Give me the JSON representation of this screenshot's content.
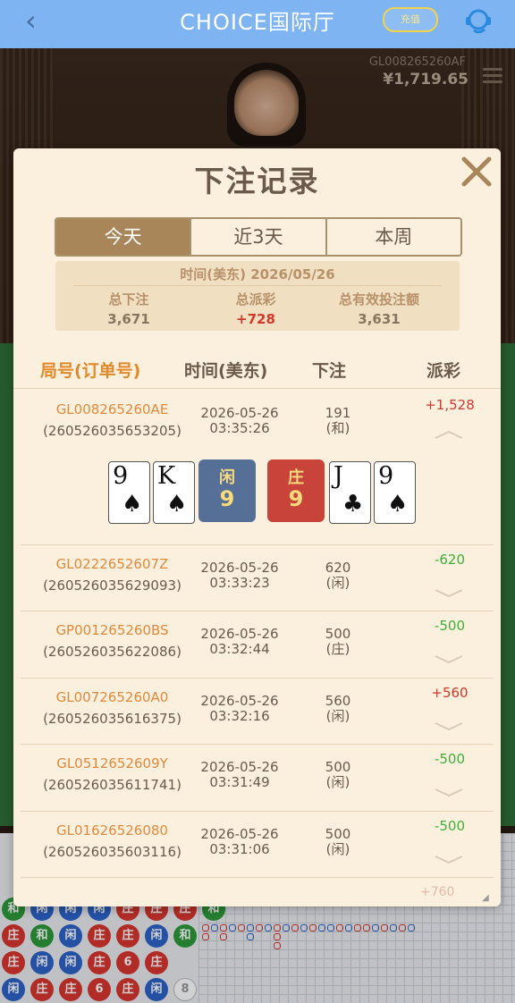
{
  "header": {
    "title": "CHOICE国际厅",
    "pill_label": "充值"
  },
  "video": {
    "game_id": "GL008265260AF",
    "balance": "¥1,719.65"
  },
  "modal": {
    "title": "下注记录",
    "tabs": [
      {
        "label": "今天",
        "active": true
      },
      {
        "label": "近3天",
        "active": false
      },
      {
        "label": "本周",
        "active": false
      }
    ],
    "summary": {
      "date_line": "时间(美东) 2026/05/26",
      "total_bet_label": "总下注",
      "total_bet": "3,671",
      "total_payout_label": "总派彩",
      "total_payout": "+728",
      "total_valid_label": "总有效投注额",
      "total_valid": "3,631"
    },
    "columns": {
      "id": "局号(订单号)",
      "time": "时间(美东)",
      "bet": "下注",
      "payout": "派彩"
    },
    "rows": [
      {
        "game_id": "GL008265260AE",
        "order": "(260526035653205)",
        "date": "2026-05-26",
        "time": "03:35:26",
        "amount": "191",
        "side": "(和)",
        "payout": "+1,528",
        "positive": true
      },
      {
        "game_id": "GL0222652607Z",
        "order": "(260526035629093)",
        "date": "2026-05-26",
        "time": "03:33:23",
        "amount": "620",
        "side": "(闲)",
        "payout": "-620",
        "positive": false
      },
      {
        "game_id": "GP001265260BS",
        "order": "(260526035622086)",
        "date": "2026-05-26",
        "time": "03:32:44",
        "amount": "500",
        "side": "(庄)",
        "payout": "-500",
        "positive": false
      },
      {
        "game_id": "GL007265260A0",
        "order": "(260526035616375)",
        "date": "2026-05-26",
        "time": "03:32:16",
        "amount": "560",
        "side": "(闲)",
        "payout": "+560",
        "positive": true
      },
      {
        "game_id": "GL0512652609Y",
        "order": "(260526035611741)",
        "date": "2026-05-26",
        "time": "03:31:49",
        "amount": "500",
        "side": "(闲)",
        "payout": "-500",
        "positive": false
      },
      {
        "game_id": "GL01626526080",
        "order": "(260526035603116)",
        "date": "2026-05-26",
        "time": "03:31:06",
        "amount": "500",
        "side": "(闲)",
        "payout": "-500",
        "positive": false
      }
    ],
    "next_row_payout_partial": "+760",
    "result": {
      "player_cards": [
        {
          "rank": "9",
          "suit": "♠"
        },
        {
          "rank": "K",
          "suit": "♠"
        }
      ],
      "player_label": "闲",
      "player_points": "9",
      "player_color": "#566f96",
      "banker_label": "庄",
      "banker_points": "9",
      "banker_color": "#c8433a",
      "banker_cards": [
        {
          "rank": "J",
          "suit": "♣"
        },
        {
          "rank": "9",
          "suit": "♠"
        }
      ]
    }
  },
  "roadmap": {
    "beads_row1": [
      "和",
      "闲",
      "闲",
      "闲",
      "庄",
      "庄",
      "庄",
      "和"
    ],
    "beads_row2": [
      "庄",
      "和",
      "闲",
      "庄",
      "庄",
      "闲",
      "和"
    ],
    "beads_row3": [
      "庄",
      "闲",
      "闲",
      "庄",
      "6",
      "庄"
    ],
    "beads_row4": [
      "闲",
      "庄",
      "庄",
      "6",
      "庄",
      "闲",
      "8"
    ]
  }
}
